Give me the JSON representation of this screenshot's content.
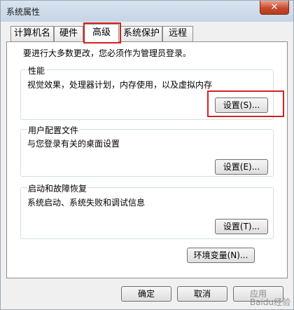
{
  "window": {
    "title": "系统属性",
    "close_label": "✕"
  },
  "tabs": [
    {
      "label": "计算机名"
    },
    {
      "label": "硬件"
    },
    {
      "label": "高级",
      "active": true
    },
    {
      "label": "系统保护"
    },
    {
      "label": "远程"
    }
  ],
  "admin_note": "要进行大多数更改，您必须作为管理员登录。",
  "performance": {
    "title": "性能",
    "desc": "视觉效果，处理器计划，内存使用，以及虚拟内存",
    "button": "设置(S)..."
  },
  "user_profiles": {
    "title": "用户配置文件",
    "desc": "与您登录有关的桌面设置",
    "button": "设置(E)..."
  },
  "startup_recovery": {
    "title": "启动和故障恢复",
    "desc": "系统启动、系统失败和调试信息",
    "button": "设置(T)..."
  },
  "env_button": "环境变量(N)...",
  "footer": {
    "ok": "确定",
    "cancel": "取消",
    "apply": "应用"
  },
  "watermark": "Baidu经验",
  "colors": {
    "highlight": "#d62020",
    "panel_bg": "#ffffff",
    "window_bg": "#f0f0f0"
  }
}
